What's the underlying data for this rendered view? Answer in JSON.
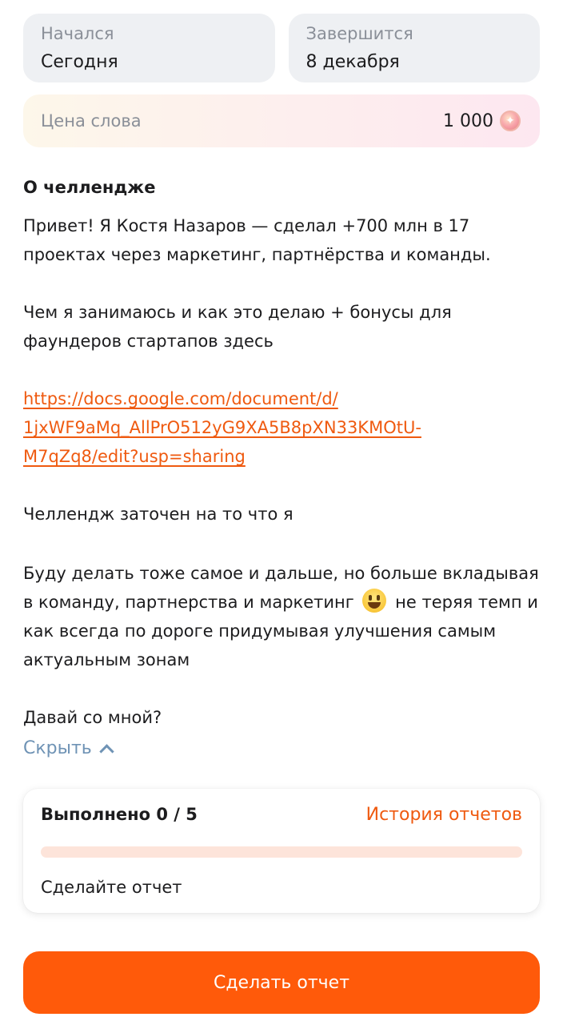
{
  "dates": {
    "start_label": "Начался",
    "start_value": "Сегодня",
    "end_label": "Завершится",
    "end_value": "8 декабря"
  },
  "price": {
    "label": "Цена слова",
    "value": "1 000",
    "icon": "star-coin-icon"
  },
  "about": {
    "title": "О челлендже",
    "p1_line1": "Привет! Я Костя Назаров — сделал +700 млн в 17",
    "p1_line2": "проектах через маркетинг, партнёрства и команды.",
    "p2_line1": "Чем я занимаюсь и как это делаю + бонусы для",
    "p2_line2": "фаундеров стартапов здесь",
    "link_line1": "https://docs.google.com/document/d/",
    "link_line2": "1jxWF9aMq_AllPrO512yG9XA5B8pXN33KMOtU-",
    "link_line3": "M7qZq8/edit?usp=sharing",
    "p3": "Челлендж заточен на то что я",
    "p4_line1": "Буду делать тоже самое и дальше, но больше вкладывая",
    "p4_line2_a": "в команду, партнерства и маркетинг",
    "p4_line2_b": "не теряя темп и",
    "p4_line3": "как всегда по дороге придумывая улучшения самым",
    "p4_line4": "актуальным зонам",
    "p5": "Давай со мной?",
    "emoji": "grinning-face-emoji"
  },
  "toggle": {
    "label": "Скрыть",
    "icon": "chevron-up-icon"
  },
  "progress": {
    "title": "Выполнено 0 / 5",
    "done": 0,
    "total": 5,
    "history_label": "История отчетов",
    "hint": "Сделайте отчет"
  },
  "cta": {
    "label": "Сделать отчет"
  },
  "colors": {
    "accent": "#ff5a0a",
    "link": "#ef5a10",
    "toggle": "#6f93b5",
    "card_bg": "#eef0f3"
  }
}
